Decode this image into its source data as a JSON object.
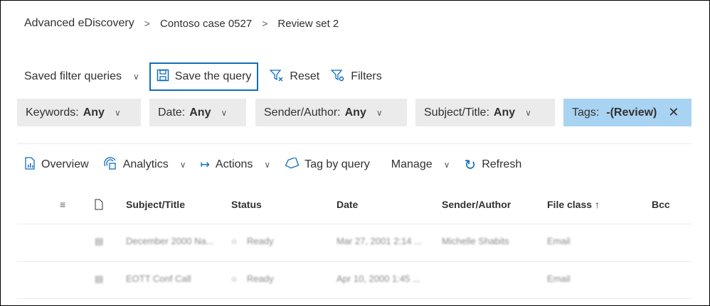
{
  "breadcrumb": [
    "Advanced eDiscovery",
    "Contoso case 0527",
    "Review set 2"
  ],
  "toolbar": {
    "saved": "Saved filter queries",
    "save": "Save the query",
    "reset": "Reset",
    "filters": "Filters"
  },
  "filters": [
    {
      "label": "Keywords:",
      "value": "Any"
    },
    {
      "label": "Date:",
      "value": "Any"
    },
    {
      "label": "Sender/Author:",
      "value": "Any"
    },
    {
      "label": "Subject/Title:",
      "value": "Any"
    },
    {
      "label": "Tags:",
      "value": "-(Review)"
    }
  ],
  "commands": {
    "overview": "Overview",
    "analytics": "Analytics",
    "actions": "Actions",
    "tag": "Tag by query",
    "manage": "Manage",
    "refresh": "Refresh"
  },
  "columns": [
    "Subject/Title",
    "Status",
    "Date",
    "Sender/Author",
    "File class ↑",
    "Bcc"
  ],
  "rows": [
    {
      "subject": "December 2000 Na...",
      "status": "Ready",
      "date": "Mar 27, 2001 2:14 ...",
      "sender": "Michelle Shabits",
      "fileclass": "Email"
    },
    {
      "subject": "EOTT Conf Call",
      "status": "Ready",
      "date": "Apr 10, 2000 1:45 ...",
      "sender": "",
      "fileclass": "Email"
    }
  ],
  "colors": {
    "accent": "#0f6cbd",
    "activePill": "#a9d3f2",
    "pill": "#ebebeb"
  }
}
